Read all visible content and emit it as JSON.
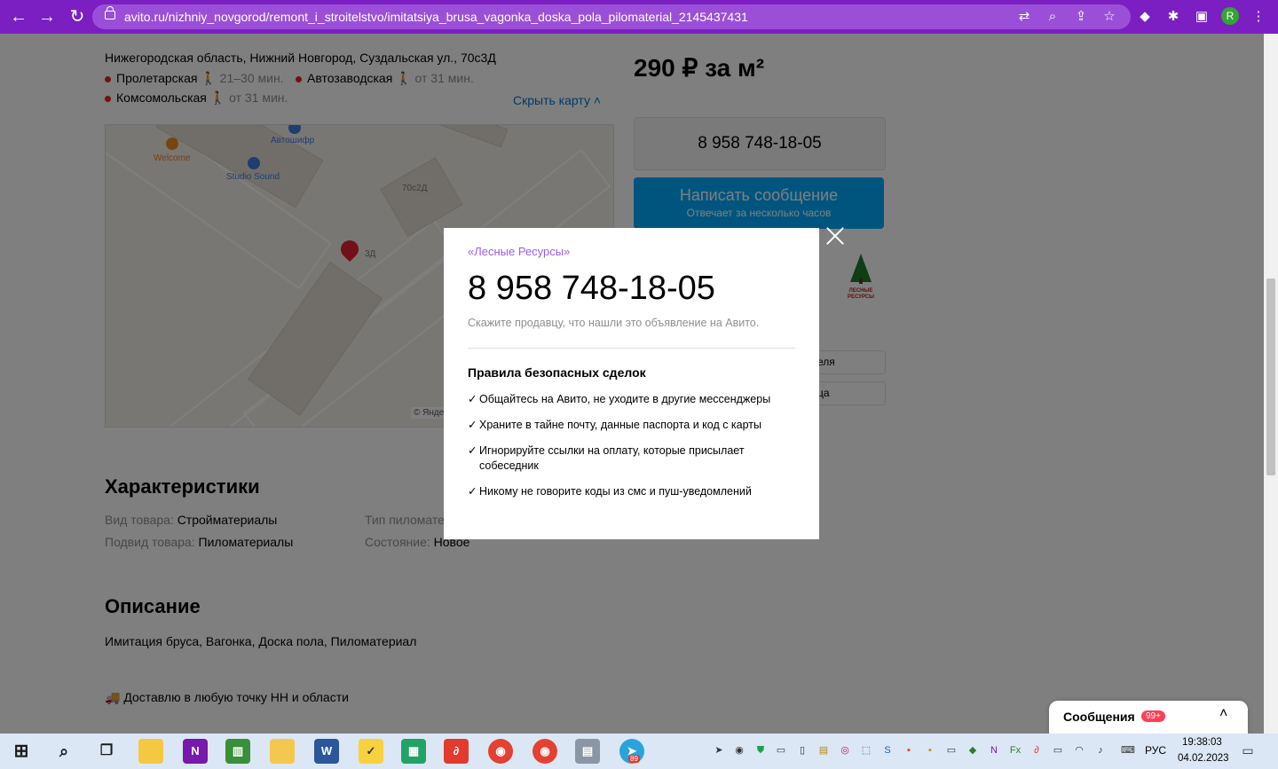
{
  "browser": {
    "url": "avito.ru/nizhniy_novgorod/remont_i_stroitelstvo/imitatsiya_brusa_vagonka_doska_pola_pilomaterial_2145437431",
    "profile_initial": "R"
  },
  "listing": {
    "address": "Нижегородская область, Нижний Новгород, Суздальская ул., 70с3Д",
    "metro": [
      {
        "name": "Пролетарская",
        "time": "21–30 мин."
      },
      {
        "name": "Автозаводская",
        "time": "от 31 мин."
      },
      {
        "name": "Комсомольская",
        "time": "от 31 мин."
      }
    ],
    "hide_map": "Скрыть карту",
    "map_labels": {
      "welcome": "Welcome",
      "avtoshop": "Автошифр",
      "studio": "Studio Sound",
      "building": "70с2Д",
      "pin": "3Д",
      "yandex": "© Янде"
    },
    "price": "290 ₽ за м²",
    "phone_button": "8 958 748-18-05",
    "message_button": "Написать сообщение",
    "message_subtitle": "Отвечает за несколько часов",
    "seller_logo_text": "ЛЕСНЫЕ РЕСУРСЫ",
    "side_btn_1": "еля",
    "side_btn_2": "ца",
    "characteristics_title": "Характеристики",
    "chars": [
      {
        "label": "Вид товара:",
        "value": "Стройматериалы"
      },
      {
        "label": "Подвид товара:",
        "value": "Пиломатериалы"
      },
      {
        "label": "Тип пиломате",
        "value": ""
      },
      {
        "label": "Состояние:",
        "value": "Новое"
      }
    ],
    "description_title": "Описание",
    "description": "Имитация бруса, Вагонка, Доска пола, Пиломатериал",
    "delivery": "🚚 Доставлю в любую точку НН и области"
  },
  "modal": {
    "seller": "«Лесные Ресурсы»",
    "phone": "8 958 748-18-05",
    "hint": "Скажите продавцу, что нашли это объявление на Авито.",
    "rules_title": "Правила безопасных сделок",
    "rules": [
      "Общайтесь на Авито, не уходите в другие мессенджеры",
      "Храните в тайне почту, данные паспорта и код с карты",
      "Игнорируйте ссылки на оплату, которые присылает",
      "собеседник",
      "Никому не говорите коды из смс и пуш-уведомлений"
    ]
  },
  "chat": {
    "label": "Сообщения",
    "badge": "99+"
  },
  "taskbar": {
    "lang": "РУС",
    "time": "19:38:03",
    "date": "04.02.2023",
    "telegram_badge": "89"
  }
}
